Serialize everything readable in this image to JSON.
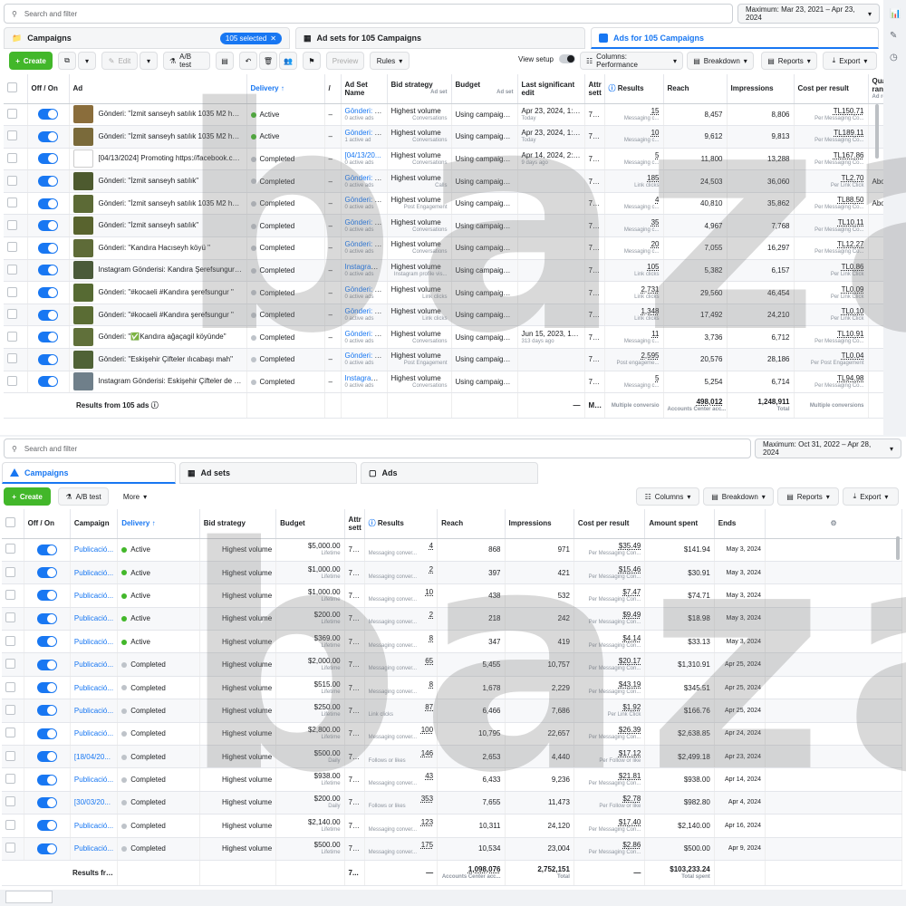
{
  "top": {
    "search_placeholder": "Search and filter",
    "date_range": "Maximum: Mar 23, 2021 – Apr 23, 2024",
    "tabs": {
      "campaigns": "Campaigns",
      "selected": "105 selected",
      "adsets": "Ad sets for 105 Campaigns",
      "ads": "Ads for 105 Campaigns"
    },
    "toolbar": {
      "create": "Create",
      "edit": "Edit",
      "ab_test": "A/B test",
      "preview": "Preview",
      "rules": "Rules",
      "view_setup": "View setup",
      "columns": "Columns: Performance",
      "breakdown": "Breakdown",
      "reports": "Reports",
      "export": "Export"
    },
    "headers": {
      "off_on": "Off / On",
      "ad": "Ad",
      "delivery": "Delivery",
      "adset_name": "Ad Set Name",
      "bid": "Bid strategy",
      "budget": "Budget",
      "budget_sub": "Ad set",
      "last_edit": "Last significant edit",
      "attr": "Attr sett",
      "results": "Results",
      "reach": "Reach",
      "impressions": "Impressions",
      "cpr": "Cost per result",
      "quality": "Quality ranking",
      "quality_sub": "Ad rele"
    },
    "rows": [
      {
        "ad": "Gönderi: \"İzmit sanseyh satılık 1035 M2 hazı...",
        "delivery": "Active",
        "adset": "Gönderi: \"İ...",
        "adset_sub": "0 active ads",
        "bid": "Highest volume",
        "bid_sub": "Conversations",
        "budget": "Using campaign ...",
        "edit": "Apr 23, 2024, 1:15...",
        "edit_sub": "Today",
        "attr": "7-...",
        "res": "15",
        "res_sub": "Messaging c...",
        "reach": "8,457",
        "impr": "8,806",
        "cpr": "TL150.71",
        "cpr_sub": "Per Messaging Co...",
        "q": ""
      },
      {
        "ad": "Gönderi: \"İzmit sanseyh satılık 1035 M2 hazı...",
        "delivery": "Active",
        "adset": "Gönderi: \"İ...",
        "adset_sub": "1 active ad",
        "bid": "Highest volume",
        "bid_sub": "Conversations",
        "budget": "Using campaign ...",
        "edit": "Apr 23, 2024, 1:15...",
        "edit_sub": "Today",
        "attr": "7-...",
        "res": "10",
        "res_sub": "Messaging c...",
        "reach": "9,612",
        "impr": "9,813",
        "cpr": "TL189.11",
        "cpr_sub": "Per Messaging Co...",
        "q": ""
      },
      {
        "ad": "[04/13/2024] Promoting https://facebook.co...",
        "delivery": "Completed",
        "adset": "[04/13/20...",
        "adset_sub": "0 active ads",
        "bid": "Highest volume",
        "bid_sub": "Conversations",
        "budget": "Using campaign ...",
        "edit": "Apr 14, 2024, 2:50...",
        "edit_sub": "9 days ago",
        "attr": "7-...",
        "res": "5",
        "res_sub": "Messaging c...",
        "reach": "11,800",
        "impr": "13,288",
        "cpr": "TL167.86",
        "cpr_sub": "Per Messaging Co...",
        "q": ""
      },
      {
        "ad": "Gönderi: \"İzmit sanseyh satılık\"",
        "delivery": "Completed",
        "adset": "Gönderi: \"İ...",
        "adset_sub": "0 active ads",
        "bid": "Highest volume",
        "bid_sub": "Calls",
        "budget": "Using campaign ...",
        "edit": "",
        "edit_sub": "",
        "attr": "7-...",
        "res": "185",
        "res_sub": "Link clicks",
        "reach": "24,503",
        "impr": "36,060",
        "cpr": "TL2.70",
        "cpr_sub": "Per Link Click",
        "q": "Abov"
      },
      {
        "ad": "Gönderi: \"İzmit sanseyh satılık 1035 M2 hazı...",
        "delivery": "Completed",
        "adset": "Gönderi: \"İ...",
        "adset_sub": "0 active ads",
        "bid": "Highest volume",
        "bid_sub": "Post Engagement",
        "budget": "Using campaign ...",
        "edit": "",
        "edit_sub": "",
        "attr": "7-...",
        "res": "4",
        "res_sub": "Messaging c...",
        "reach": "40,810",
        "impr": "35,862",
        "cpr": "TL88.50",
        "cpr_sub": "Per Messaging Co...",
        "q": "Abov"
      },
      {
        "ad": "Gönderi: \"İzmit sanseyh satılık\"",
        "delivery": "Completed",
        "adset": "Gönderi: \"İ...",
        "adset_sub": "0 active ads",
        "bid": "Highest volume",
        "bid_sub": "Conversations",
        "budget": "Using campaign ...",
        "edit": "",
        "edit_sub": "",
        "attr": "7-...",
        "res": "35",
        "res_sub": "Messaging c...",
        "reach": "4,967",
        "impr": "7,768",
        "cpr": "TL10.11",
        "cpr_sub": "Per Messaging Co...",
        "q": ""
      },
      {
        "ad": "Gönderi: \"Kandıra Hacıseyh köyü \"",
        "delivery": "Completed",
        "adset": "Gönderi: \"...",
        "adset_sub": "0 active ads",
        "bid": "Highest volume",
        "bid_sub": "Conversations",
        "budget": "Using campaign ...",
        "edit": "",
        "edit_sub": "",
        "attr": "7-...",
        "res": "20",
        "res_sub": "Messaging c...",
        "reach": "7,055",
        "impr": "16,297",
        "cpr": "TL12.27",
        "cpr_sub": "Per Messaging Co...",
        "q": ""
      },
      {
        "ad": "Instagram Gönderisi: Kandıra Şerefsungur a...",
        "delivery": "Completed",
        "adset": "Instagram ...",
        "adset_sub": "0 active ads",
        "bid": "Highest volume",
        "bid_sub": "Instagram profile vis...",
        "budget": "Using campaign ...",
        "edit": "",
        "edit_sub": "",
        "attr": "7-...",
        "res": "105",
        "res_sub": "Link clicks",
        "reach": "5,382",
        "impr": "6,157",
        "cpr": "TL0.86",
        "cpr_sub": "Per Link Click",
        "q": ""
      },
      {
        "ad": "Gönderi: \"#kocaeli #Kandıra şerefsungur \"",
        "delivery": "Completed",
        "adset": "Gönderi: \"...",
        "adset_sub": "0 active ads",
        "bid": "Highest volume",
        "bid_sub": "Link clicks",
        "budget": "Using campaign ...",
        "edit": "",
        "edit_sub": "",
        "attr": "7-...",
        "res": "2,731",
        "res_sub": "Link clicks",
        "reach": "29,560",
        "impr": "46,454",
        "cpr": "TL0.09",
        "cpr_sub": "Per Link Click",
        "q": ""
      },
      {
        "ad": "Gönderi: \"#kocaeli #Kandıra şerefsungur \"",
        "delivery": "Completed",
        "adset": "Gönderi: \"...",
        "adset_sub": "0 active ads",
        "bid": "Highest volume",
        "bid_sub": "Link clicks",
        "budget": "Using campaign ...",
        "edit": "",
        "edit_sub": "",
        "attr": "7-...",
        "res": "1,348",
        "res_sub": "Link clicks",
        "reach": "17,492",
        "impr": "24,210",
        "cpr": "TL0.10",
        "cpr_sub": "Per Link Click",
        "q": ""
      },
      {
        "ad": "Gönderi: \"✅Kandıra ağaçagil köyünde\"",
        "delivery": "Completed",
        "adset": "Gönderi: \"...",
        "adset_sub": "0 active ads",
        "bid": "Highest volume",
        "bid_sub": "Conversations",
        "budget": "Using campaign ...",
        "edit": "Jun 15, 2023, 12:...",
        "edit_sub": "313 days ago",
        "attr": "7-...",
        "res": "11",
        "res_sub": "Messaging c...",
        "reach": "3,736",
        "impr": "6,712",
        "cpr": "TL10.91",
        "cpr_sub": "Per Messaging Co...",
        "q": ""
      },
      {
        "ad": "Gönderi: \"Eskişehir Çifteler ılıcabaşı mah\"",
        "delivery": "Completed",
        "adset": "Gönderi: \"...",
        "adset_sub": "0 active ads",
        "bid": "Highest volume",
        "bid_sub": "Post Engagement",
        "budget": "Using campaign ...",
        "edit": "",
        "edit_sub": "",
        "attr": "7-...",
        "res": "2,595",
        "res_sub": "Post engageme...",
        "reach": "20,576",
        "impr": "28,186",
        "cpr": "TL0.04",
        "cpr_sub": "Per Post Engagement",
        "q": ""
      },
      {
        "ad": "Instagram Gönderisi: Eskişehir Çifteler de 4...",
        "delivery": "Completed",
        "adset": "Instagram ...",
        "adset_sub": "0 active ads",
        "bid": "Highest volume",
        "bid_sub": "Conversations",
        "budget": "Using campaign ...",
        "edit": "",
        "edit_sub": "",
        "attr": "7-...",
        "res": "5",
        "res_sub": "Messaging c...",
        "reach": "5,254",
        "impr": "6,714",
        "cpr": "TL94.98",
        "cpr_sub": "Per Messaging Co...",
        "q": ""
      }
    ],
    "footer": {
      "label": "Results from 105 ads",
      "dash1": "—",
      "attr": "M...",
      "res_sub": "Multiple conversio",
      "reach": "498,012",
      "reach_sub": "Accounts Center acc...",
      "impr": "1,248,911",
      "impr_sub": "Total",
      "cpr_sub": "Multiple conversions"
    }
  },
  "bottom": {
    "search_placeholder": "Search and filter",
    "date_range": "Maximum: Oct 31, 2022 – Apr 28, 2024",
    "tabs": {
      "campaigns": "Campaigns",
      "adsets": "Ad sets",
      "ads": "Ads"
    },
    "toolbar": {
      "create": "Create",
      "ab_test": "A/B test",
      "more": "More",
      "columns": "Columns",
      "breakdown": "Breakdown",
      "reports": "Reports",
      "export": "Export"
    },
    "headers": {
      "off_on": "Off / On",
      "campaign": "Campaign",
      "delivery": "Delivery",
      "bid": "Bid strategy",
      "budget": "Budget",
      "attr": "Attr sett",
      "results": "Results",
      "reach": "Reach",
      "impressions": "Impressions",
      "cpr": "Cost per result",
      "spent": "Amount spent",
      "ends": "Ends"
    },
    "rows": [
      {
        "c": "Publicació...",
        "d": "Active",
        "b": "Highest volume",
        "bu": "$5,000.00",
        "bu_sub": "Lifetime",
        "a": "7-...",
        "r": "4",
        "r_sub": "Messaging conver...",
        "reach": "868",
        "i": "971",
        "cpr": "$35.49",
        "cpr_sub": "Per Messaging Con...",
        "s": "$141.94",
        "e": "May 3, 2024"
      },
      {
        "c": "Publicació...",
        "d": "Active",
        "b": "Highest volume",
        "bu": "$1,000.00",
        "bu_sub": "Lifetime",
        "a": "7-...",
        "r": "2",
        "r_sub": "Messaging conver...",
        "reach": "397",
        "i": "421",
        "cpr": "$15.46",
        "cpr_sub": "Per Messaging Con...",
        "s": "$30.91",
        "e": "May 3, 2024"
      },
      {
        "c": "Publicació...",
        "d": "Active",
        "b": "Highest volume",
        "bu": "$1,000.00",
        "bu_sub": "Lifetime",
        "a": "7-...",
        "r": "10",
        "r_sub": "Messaging conver...",
        "reach": "438",
        "i": "532",
        "cpr": "$7.47",
        "cpr_sub": "Per Messaging Con...",
        "s": "$74.71",
        "e": "May 3, 2024"
      },
      {
        "c": "Publicació...",
        "d": "Active",
        "b": "Highest volume",
        "bu": "$200.00",
        "bu_sub": "Lifetime",
        "a": "7-...",
        "r": "2",
        "r_sub": "Messaging conver...",
        "reach": "218",
        "i": "242",
        "cpr": "$9.49",
        "cpr_sub": "Per Messaging Con...",
        "s": "$18.98",
        "e": "May 3, 2024"
      },
      {
        "c": "Publicació...",
        "d": "Active",
        "b": "Highest volume",
        "bu": "$369.00",
        "bu_sub": "Lifetime",
        "a": "7-...",
        "r": "8",
        "r_sub": "Messaging conver...",
        "reach": "347",
        "i": "419",
        "cpr": "$4.14",
        "cpr_sub": "Per Messaging Con...",
        "s": "$33.13",
        "e": "May 3, 2024"
      },
      {
        "c": "Publicació...",
        "d": "Completed",
        "b": "Highest volume",
        "bu": "$2,000.00",
        "bu_sub": "Lifetime",
        "a": "7-...",
        "r": "65",
        "r_sub": "Messaging conver...",
        "reach": "5,455",
        "i": "10,757",
        "cpr": "$20.17",
        "cpr_sub": "Per Messaging Con...",
        "s": "$1,310.91",
        "e": "Apr 25, 2024"
      },
      {
        "c": "Publicació...",
        "d": "Completed",
        "b": "Highest volume",
        "bu": "$515.00",
        "bu_sub": "Lifetime",
        "a": "7-...",
        "r": "8",
        "r_sub": "Messaging conver...",
        "reach": "1,678",
        "i": "2,229",
        "cpr": "$43.19",
        "cpr_sub": "Per Messaging Con...",
        "s": "$345.51",
        "e": "Apr 25, 2024"
      },
      {
        "c": "Publicació...",
        "d": "Completed",
        "b": "Highest volume",
        "bu": "$250.00",
        "bu_sub": "Lifetime",
        "a": "7-...",
        "r": "87",
        "r_sub": "Link clicks",
        "reach": "6,466",
        "i": "7,686",
        "cpr": "$1.92",
        "cpr_sub": "Per Link Click",
        "s": "$166.76",
        "e": "Apr 25, 2024"
      },
      {
        "c": "Publicació...",
        "d": "Completed",
        "b": "Highest volume",
        "bu": "$2,800.00",
        "bu_sub": "Lifetime",
        "a": "7-...",
        "r": "100",
        "r_sub": "Messaging conver...",
        "reach": "10,795",
        "i": "22,657",
        "cpr": "$26.39",
        "cpr_sub": "Per Messaging Con...",
        "s": "$2,638.85",
        "e": "Apr 24, 2024"
      },
      {
        "c": "[18/04/20...",
        "d": "Completed",
        "b": "Highest volume",
        "bu": "$500.00",
        "bu_sub": "Daily",
        "a": "7-...",
        "r": "146",
        "r_sub": "Follows or likes",
        "reach": "2,653",
        "i": "4,440",
        "cpr": "$17.12",
        "cpr_sub": "Per Follow or like",
        "s": "$2,499.18",
        "e": "Apr 23, 2024"
      },
      {
        "c": "Publicació...",
        "d": "Completed",
        "b": "Highest volume",
        "bu": "$938.00",
        "bu_sub": "Lifetime",
        "a": "7-...",
        "r": "43",
        "r_sub": "Messaging conver...",
        "reach": "6,433",
        "i": "9,236",
        "cpr": "$21.81",
        "cpr_sub": "Per Messaging Con...",
        "s": "$938.00",
        "e": "Apr 14, 2024"
      },
      {
        "c": "[30/03/20...",
        "d": "Completed",
        "b": "Highest volume",
        "bu": "$200.00",
        "bu_sub": "Daily",
        "a": "7-...",
        "r": "353",
        "r_sub": "Follows or likes",
        "reach": "7,655",
        "i": "11,473",
        "cpr": "$2.78",
        "cpr_sub": "Per Follow or like",
        "s": "$982.80",
        "e": "Apr 4, 2024"
      },
      {
        "c": "Publicació...",
        "d": "Completed",
        "b": "Highest volume",
        "bu": "$2,140.00",
        "bu_sub": "Lifetime",
        "a": "7-...",
        "r": "123",
        "r_sub": "Messaging conver...",
        "reach": "10,311",
        "i": "24,120",
        "cpr": "$17.40",
        "cpr_sub": "Per Messaging Con...",
        "s": "$2,140.00",
        "e": "Apr 16, 2024"
      },
      {
        "c": "Publicació...",
        "d": "Completed",
        "b": "Highest volume",
        "bu": "$500.00",
        "bu_sub": "Lifetime",
        "a": "7-...",
        "r": "175",
        "r_sub": "Messaging conver...",
        "reach": "10,534",
        "i": "23,004",
        "cpr": "$2.86",
        "cpr_sub": "Per Messaging Con...",
        "s": "$500.00",
        "e": "Apr 9, 2024"
      }
    ],
    "footer": {
      "label": "Results fro...",
      "attr": "7...",
      "dash": "—",
      "reach": "1,098,076",
      "reach_sub": "Accounts Center acc...",
      "impr": "2,752,151",
      "impr_sub": "Total",
      "dash2": "—",
      "spent": "$103,233.24",
      "spent_sub": "Total spent"
    }
  },
  "watermark": "baza",
  "colors": {
    "accent": "#1877f2",
    "active": "#42b72a",
    "completed": "#bec3c9"
  }
}
